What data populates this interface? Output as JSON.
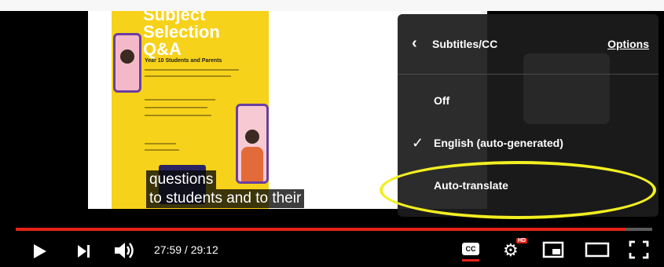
{
  "poster": {
    "title": "Subject Selection Q&A",
    "subtitle": "Year 10 Students and Parents"
  },
  "captions": {
    "line1": "questions",
    "line2": "to students and to their"
  },
  "menu": {
    "title": "Subtitles/CC",
    "options_label": "Options",
    "items": [
      {
        "label": "Off",
        "selected": false
      },
      {
        "label": "English (auto-generated)",
        "selected": true
      },
      {
        "label": "Auto-translate",
        "selected": false
      }
    ]
  },
  "player": {
    "time": "27:59 / 29:12",
    "progress": 0.958,
    "cc_label": "CC",
    "hd_label": "HD"
  },
  "colors": {
    "accent_red": "#e62117",
    "highlight_yellow": "#f2ee22",
    "poster_yellow": "#f7d21a"
  },
  "icons": {
    "play": "play-icon",
    "next": "skip-next-icon",
    "volume": "volume-icon",
    "subtitles": "subtitles-icon",
    "settings": "gear-icon",
    "miniplayer": "miniplayer-icon",
    "theater": "theater-mode-icon",
    "fullscreen": "fullscreen-icon",
    "back": "chevron-left-icon",
    "check": "check-icon"
  }
}
